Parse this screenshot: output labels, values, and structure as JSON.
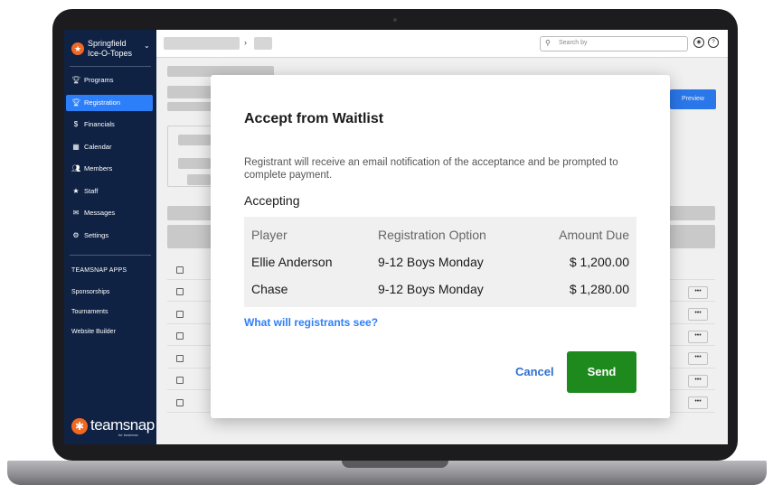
{
  "org": {
    "name": "Springfield Ice-O-Topes"
  },
  "sidebar": {
    "items": [
      {
        "label": "Programs",
        "icon": "trophy-icon",
        "active": false
      },
      {
        "label": "Registration",
        "icon": "trophy-icon",
        "active": true
      },
      {
        "label": "Financials",
        "icon": "dollar-icon",
        "active": false
      },
      {
        "label": "Calendar",
        "icon": "calendar-icon",
        "active": false
      },
      {
        "label": "Members",
        "icon": "people-icon",
        "active": false
      },
      {
        "label": "Staff",
        "icon": "star-icon",
        "active": false
      },
      {
        "label": "Messages",
        "icon": "envelope-icon",
        "active": false
      },
      {
        "label": "Settings",
        "icon": "gear-icon",
        "active": false
      }
    ],
    "apps_title": "TEAMSNAP APPS",
    "apps": [
      "Sponsorships",
      "Tournaments",
      "Website Builder"
    ],
    "brand": {
      "word": "teamsnap",
      "sub": "for business"
    }
  },
  "topbar": {
    "search_placeholder": "Search by"
  },
  "main": {
    "preview_label": "Preview",
    "row_action": "•••"
  },
  "modal": {
    "title": "Accept from Waitlist",
    "description": "Registrant will receive an email notification of the acceptance and be prompted to complete payment.",
    "accepting_label": "Accepting",
    "columns": [
      "Player",
      "Registration Option",
      "Amount Due"
    ],
    "rows": [
      {
        "player": "Ellie Anderson",
        "option": "9-12 Boys Monday",
        "amount": "$ 1,200.00"
      },
      {
        "player": "Chase",
        "option": "9-12 Boys Monday",
        "amount": "$ 1,280.00"
      }
    ],
    "link": "What will registrants see?",
    "cancel_label": "Cancel",
    "send_label": "Send"
  },
  "colors": {
    "sidebar": "#0f2244",
    "accent": "#2d7ff9",
    "send": "#1e8a1e",
    "brand": "#f26722"
  }
}
